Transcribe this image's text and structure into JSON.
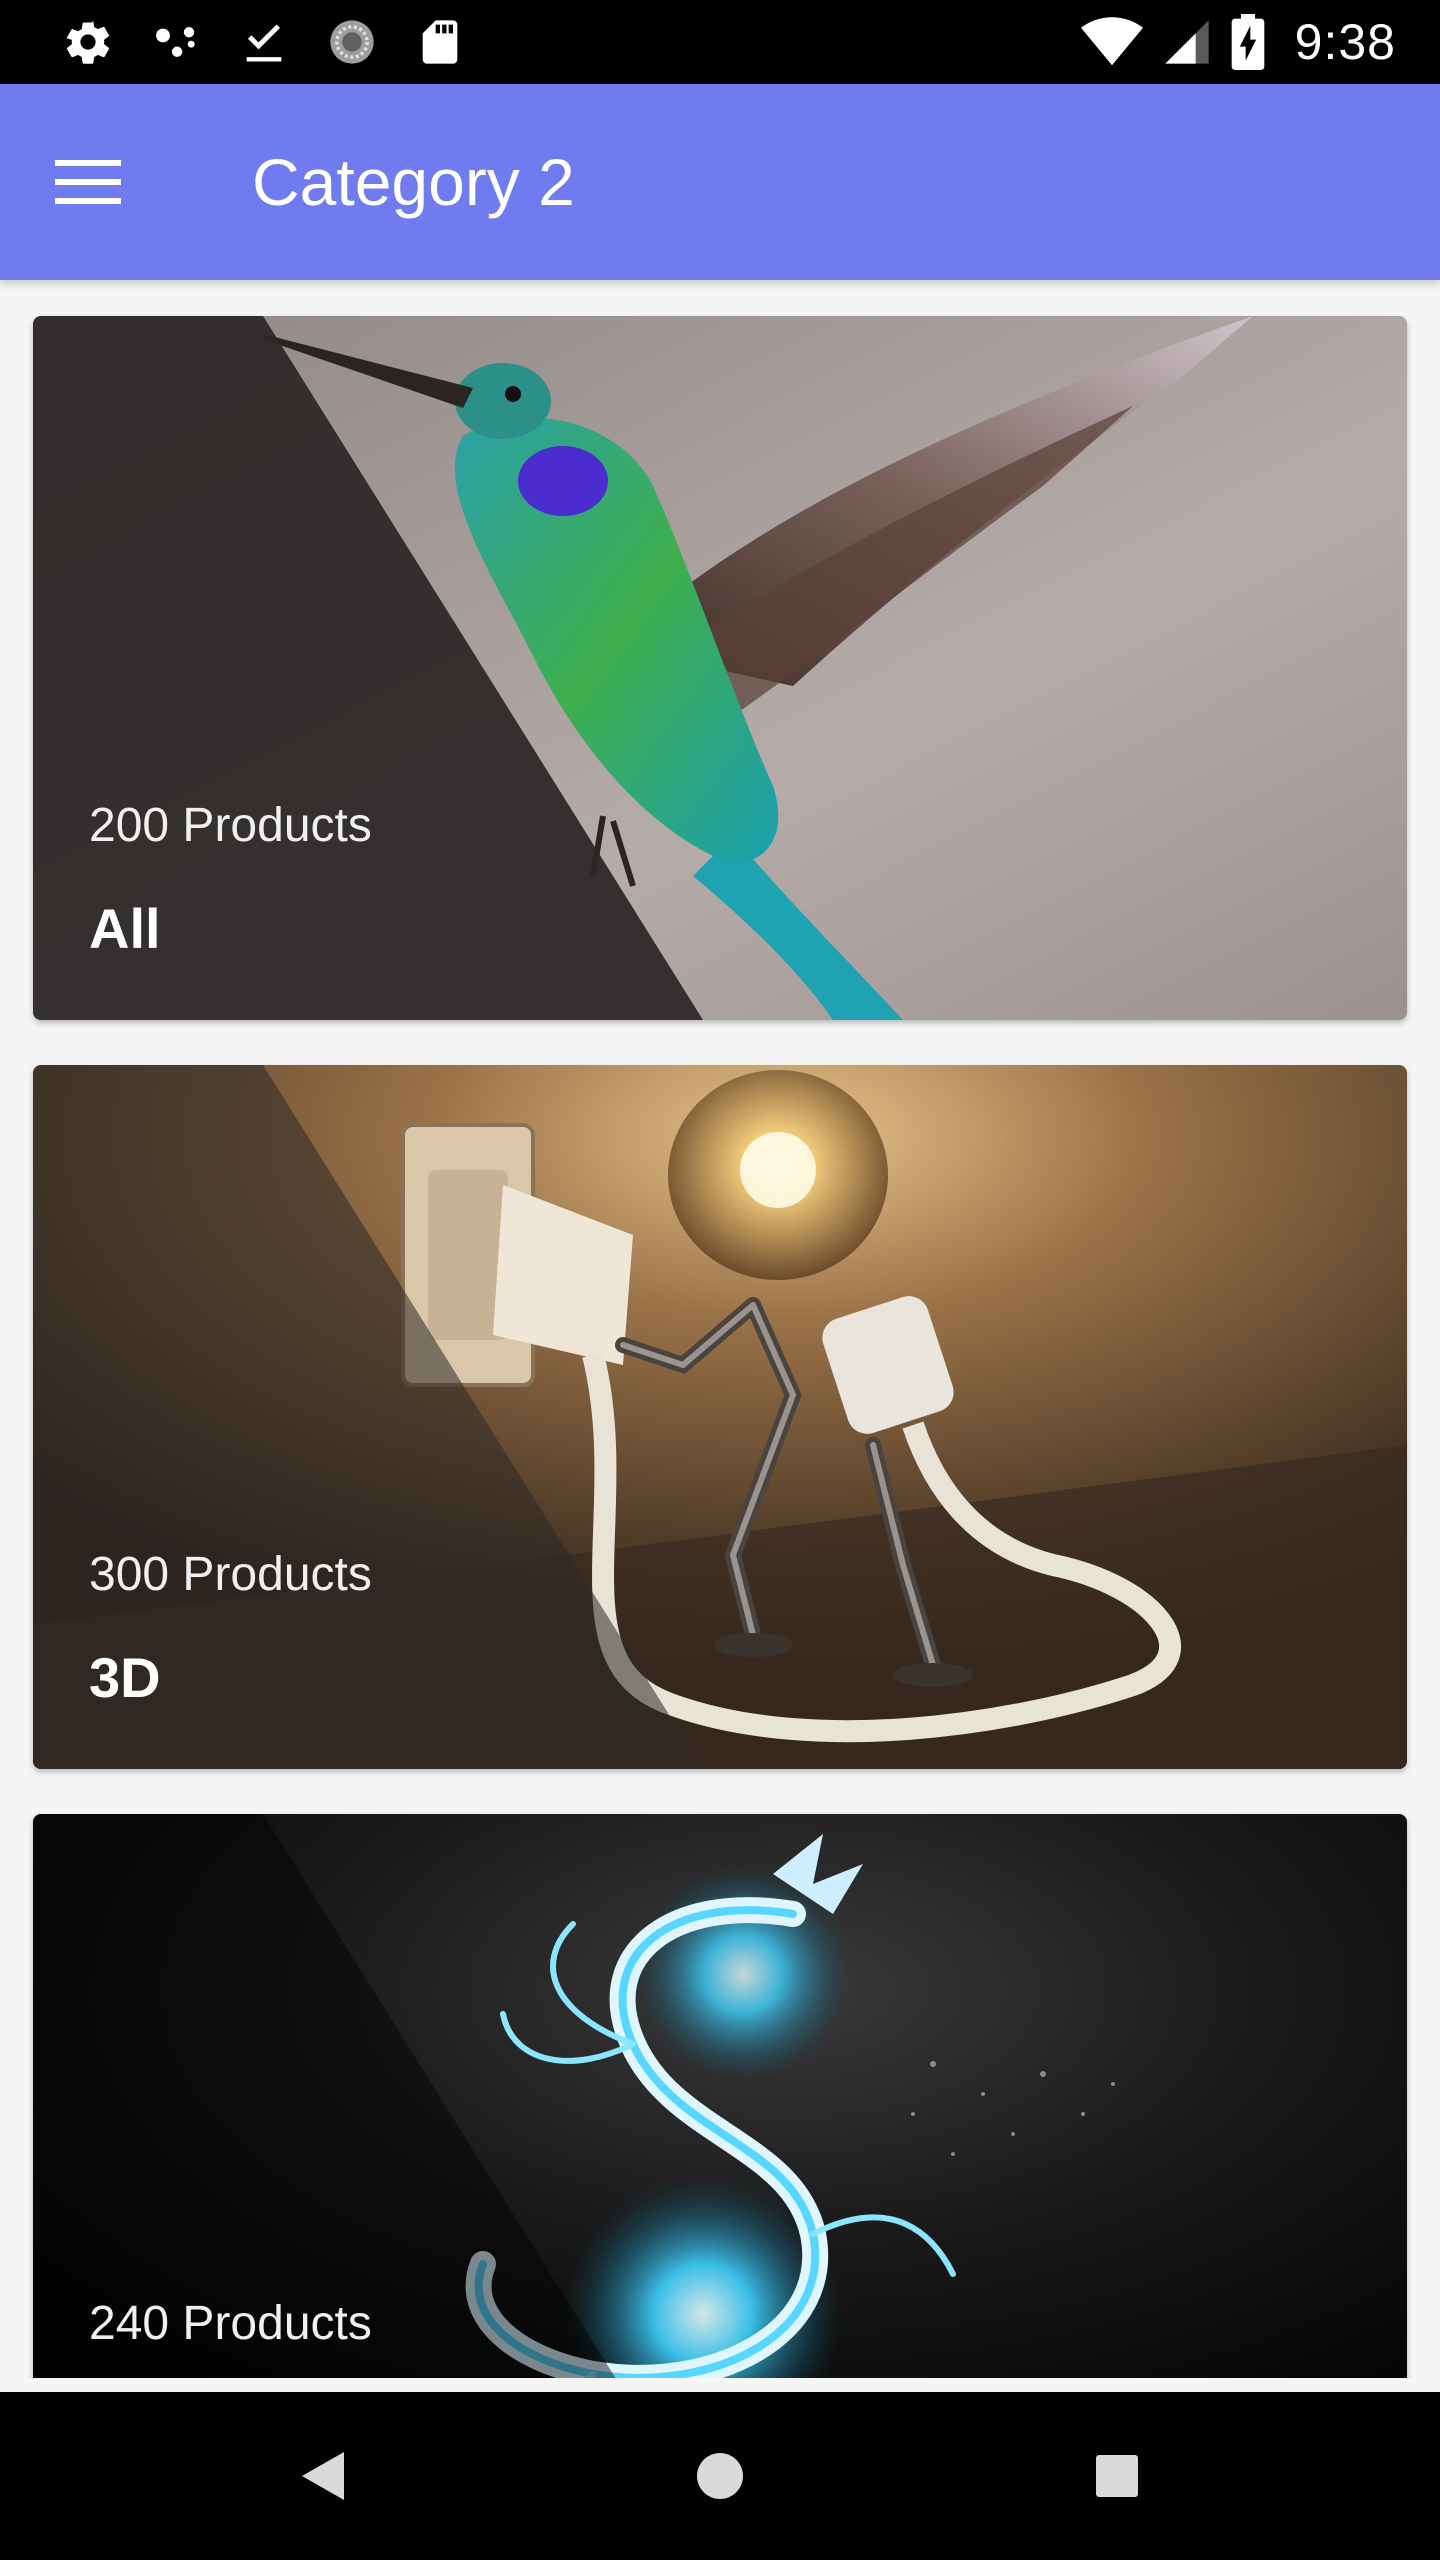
{
  "status_bar": {
    "time": "9:38",
    "icons": [
      "settings-icon",
      "assistant-dots-icon",
      "download-done-icon",
      "sync-circle-icon",
      "sd-card-icon",
      "wifi-icon",
      "cell-signal-icon",
      "battery-charging-icon"
    ]
  },
  "app_bar": {
    "title": "Category 2",
    "menu_icon": "menu-icon"
  },
  "categories": [
    {
      "count": "200 Products",
      "name": "All",
      "image": "hummingbird"
    },
    {
      "count": "300 Products",
      "name": "3D",
      "image": "lightbulb-robot"
    },
    {
      "count": "240 Products",
      "name": "",
      "image": "glowing-dragon"
    }
  ],
  "nav_bar": {
    "icons": [
      "back-icon",
      "home-icon",
      "recents-icon"
    ]
  },
  "colors": {
    "app_bar": "#717bf0",
    "background": "#f5f5f5",
    "status_bar": "#000000",
    "nav_bar": "#000000"
  }
}
